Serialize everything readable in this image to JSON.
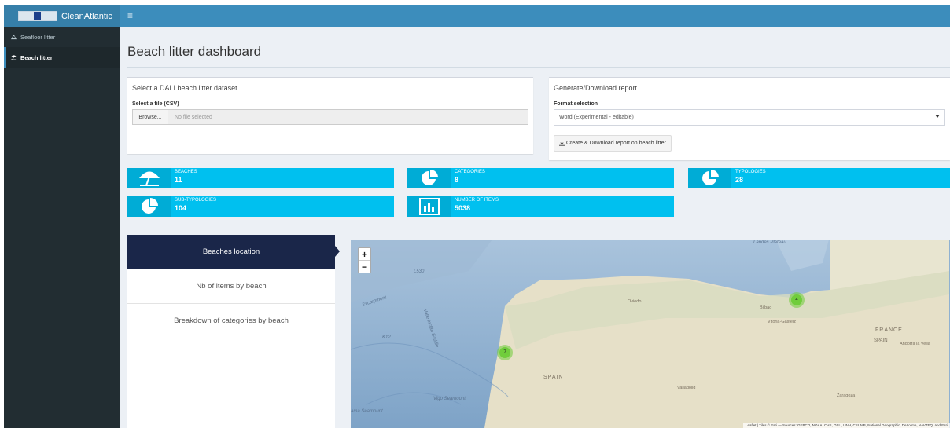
{
  "app": {
    "brand": "CleanAtlantic",
    "menu_icon": "hamburger-icon"
  },
  "sidebar": {
    "items": [
      {
        "label": "Seafloor litter",
        "icon": "seafloor-icon",
        "active": false
      },
      {
        "label": "Beach litter",
        "icon": "beach-umbrella-icon",
        "active": true
      }
    ]
  },
  "page": {
    "title": "Beach litter dashboard"
  },
  "dataset_box": {
    "title": "Select a DALI beach litter dataset",
    "file_label": "Select a file (CSV)",
    "browse_label": "Browse...",
    "file_value": "No file selected"
  },
  "report_box": {
    "title": "Generate/Download report",
    "format_label": "Format selection",
    "format_value": "Word (Experimental - editable)",
    "button_label": "Create & Download report on beach litter"
  },
  "stats": [
    {
      "label": "BEACHES",
      "value": "11",
      "icon": "beach-umbrella-icon"
    },
    {
      "label": "CATEGORIES",
      "value": "8",
      "icon": "pie-chart-icon"
    },
    {
      "label": "TYPOLOGIES",
      "value": "28",
      "icon": "pie-chart-icon"
    },
    {
      "label": "SUB-TYPOLOGIES",
      "value": "104",
      "icon": "pie-chart-icon"
    },
    {
      "label": "NUMBER OF ITEMS",
      "value": "5038",
      "icon": "bar-chart-icon"
    }
  ],
  "tabs": [
    {
      "label": "Beaches location",
      "active": true
    },
    {
      "label": "Nb of items by beach",
      "active": false
    },
    {
      "label": "Breakdown of categories by beach",
      "active": false
    }
  ],
  "map": {
    "zoom_in": "+",
    "zoom_out": "−",
    "clusters": [
      "4",
      "7"
    ],
    "labels": {
      "landes_plateau": "Landes Plateau",
      "escarpment": "Escarpment",
      "valle_inclan": "Valle Inclán Saddle",
      "spain_west": "SPAIN",
      "france": "FRANCE",
      "spain_east": "SPAIN",
      "bilbao": "Bilbao",
      "vitoria": "Vitoria-Gasteiz",
      "oviedo": "Oviedo",
      "valladolid": "Valladolid",
      "zaragoza": "Zaragoza",
      "vigo_seamount": "Vigo Seamount",
      "vasco_seamount": "ama Seamount",
      "spot_1": "L530",
      "spot_2": "K12",
      "andorra": "Andorra la Vella"
    },
    "attribution": "Leaflet | Tiles © Esri — Sources: GEBCO, NOAA, CHS, OSU, UNH, CSUMB, National Geographic, DeLorme, NAVTEQ, and Esri"
  }
}
